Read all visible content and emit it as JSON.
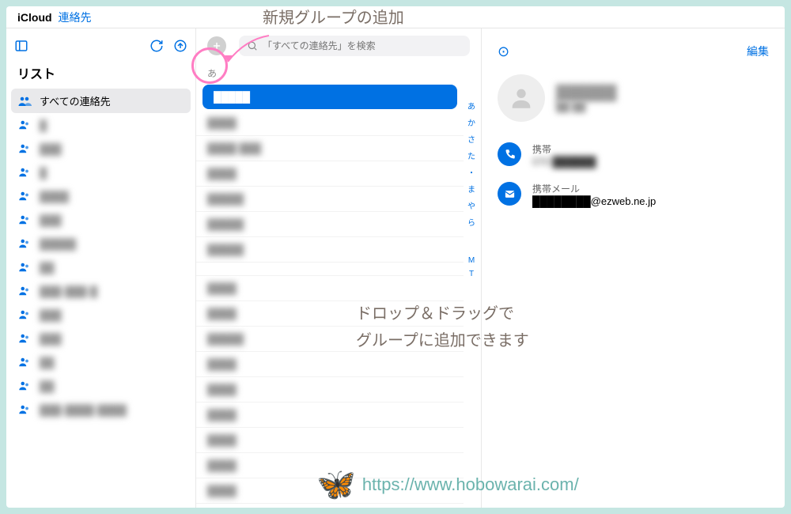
{
  "titlebar": {
    "app_name": "iCloud",
    "section": "連絡先"
  },
  "sidebar": {
    "heading": "リスト",
    "all_contacts": "すべての連絡先",
    "groups": [
      "█",
      "███",
      "█",
      "████",
      "███",
      "█████",
      "██",
      "███-███-█",
      "███",
      "███",
      "██",
      "██",
      "███-████-████"
    ]
  },
  "list": {
    "search_placeholder": "「すべての連絡先」を検索",
    "section_letter": "あ",
    "contacts": [
      "█████",
      "████",
      "████ ███",
      "████",
      "█████",
      "█████",
      "█████",
      "",
      "████",
      "████",
      "█████",
      "████",
      "████",
      "████",
      "████",
      "████",
      "████"
    ],
    "index": [
      "あ",
      "か",
      "さ",
      "た",
      "・",
      "ま",
      "や",
      "ら",
      "",
      "",
      "",
      "",
      "",
      "M",
      "T"
    ]
  },
  "detail": {
    "edit": "編集",
    "name": "██████",
    "sub": "██ ██",
    "phone_label": "携帯",
    "phone_value": "070 ██████",
    "email_label": "携帯メール",
    "email_value": "████████@ezweb.ne.jp"
  },
  "annotations": {
    "a1": "新規グループの追加",
    "a2_line1": "ドロップ＆ドラッグで",
    "a2_line2": "グループに追加できます",
    "watermark_url": "https://www.hobowarai.com/"
  }
}
